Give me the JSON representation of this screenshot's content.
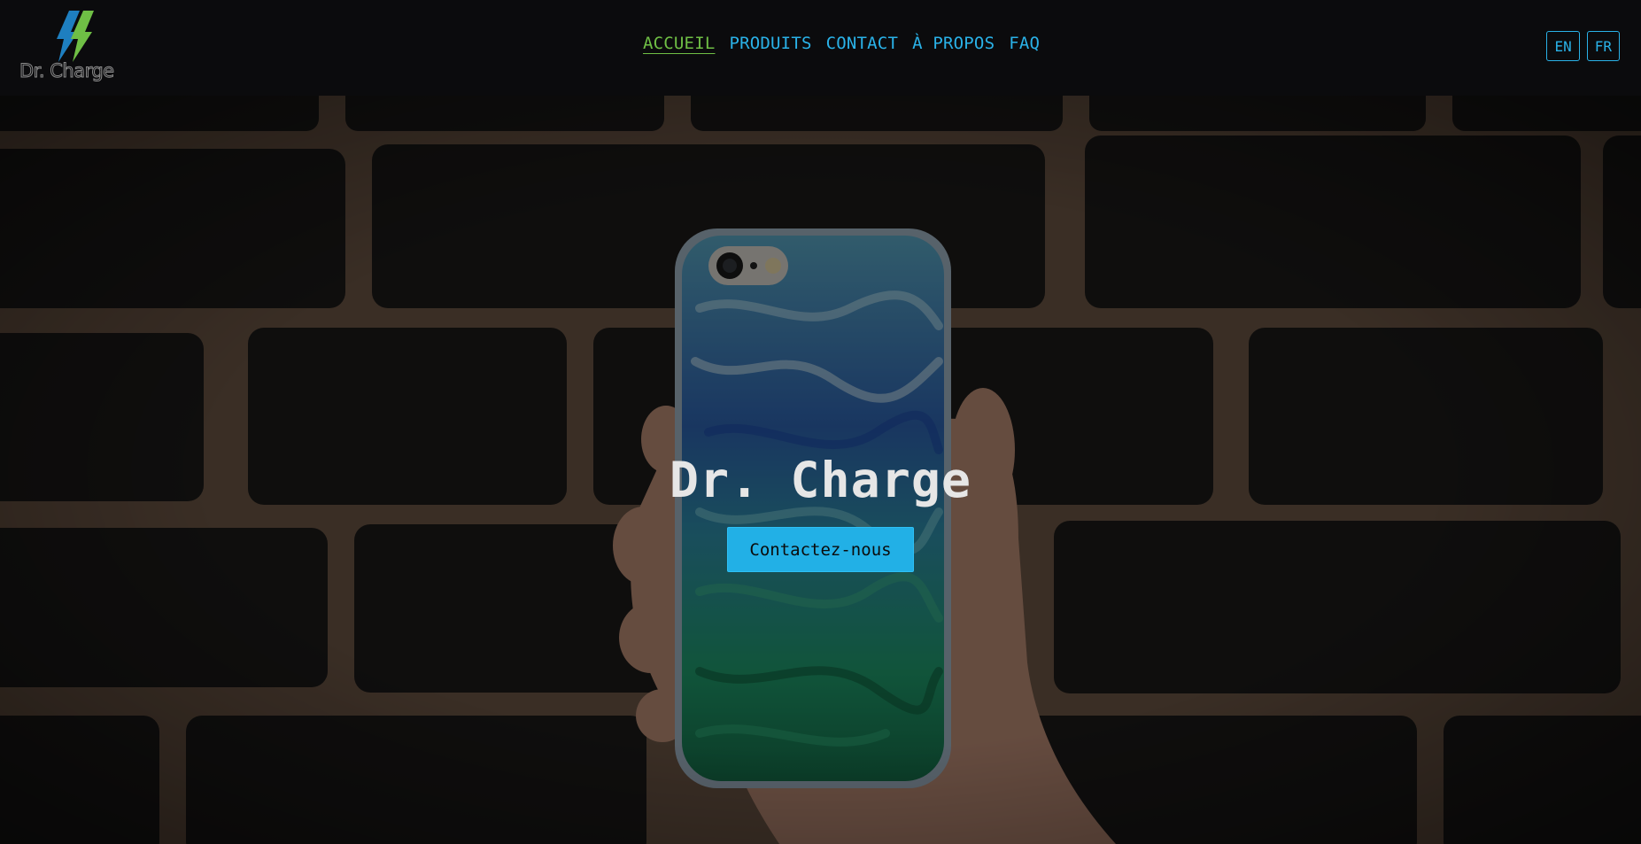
{
  "brand": {
    "logo_text": "Dr. Charge"
  },
  "nav": {
    "items": [
      {
        "label": "ACCUEIL",
        "active": true
      },
      {
        "label": "PRODUITS",
        "active": false
      },
      {
        "label": "CONTACT",
        "active": false
      },
      {
        "label": "À PROPOS",
        "active": false
      },
      {
        "label": "FAQ",
        "active": false
      }
    ]
  },
  "language": {
    "en": "EN",
    "fr": "FR"
  },
  "hero": {
    "title": "Dr. Charge",
    "cta_label": "Contactez-nous",
    "background_image": "phone-in-hand-brick-wall"
  },
  "colors": {
    "accent": "#2ab2e8",
    "active_nav": "#6fbf45",
    "cta": "#22b0e6",
    "header_bg": "#0b0b0d"
  }
}
